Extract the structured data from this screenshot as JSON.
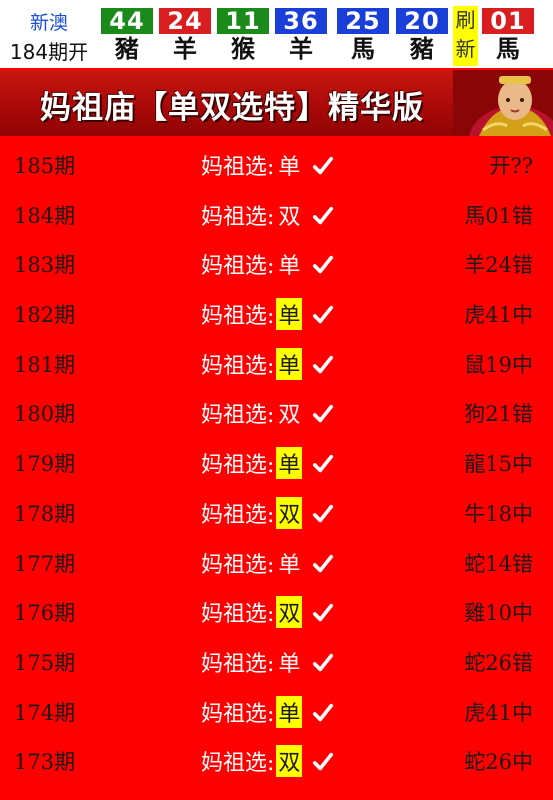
{
  "header": {
    "region": "新澳",
    "period_open": "184期开",
    "balls": [
      {
        "number": "44",
        "zodiac": "豬",
        "color": "#1a8a1a"
      },
      {
        "number": "24",
        "zodiac": "羊",
        "color": "#d81e1e"
      },
      {
        "number": "11",
        "zodiac": "猴",
        "color": "#1a8a1a"
      },
      {
        "number": "36",
        "zodiac": "羊",
        "color": "#1a3fd8"
      },
      {
        "number": "25",
        "zodiac": "馬",
        "color": "#1a3fd8"
      },
      {
        "number": "20",
        "zodiac": "豬",
        "color": "#1a3fd8"
      }
    ],
    "refresh_line1": "刷",
    "refresh_line2": "新",
    "special": {
      "number": "01",
      "zodiac": "馬",
      "color": "#d81e1e"
    }
  },
  "banner": {
    "title": "妈祖庙【单双选特】精华版"
  },
  "records": [
    {
      "period": "185期",
      "label": "妈祖选:",
      "pick": "单",
      "highlight": false,
      "result": "开??"
    },
    {
      "period": "184期",
      "label": "妈祖选:",
      "pick": "双",
      "highlight": false,
      "result": "馬01错"
    },
    {
      "period": "183期",
      "label": "妈祖选:",
      "pick": "单",
      "highlight": false,
      "result": "羊24错"
    },
    {
      "period": "182期",
      "label": "妈祖选:",
      "pick": "单",
      "highlight": true,
      "result": "虎41中"
    },
    {
      "period": "181期",
      "label": "妈祖选:",
      "pick": "单",
      "highlight": true,
      "result": "鼠19中"
    },
    {
      "period": "180期",
      "label": "妈祖选:",
      "pick": "双",
      "highlight": false,
      "result": "狗21错"
    },
    {
      "period": "179期",
      "label": "妈祖选:",
      "pick": "单",
      "highlight": true,
      "result": "龍15中"
    },
    {
      "period": "178期",
      "label": "妈祖选:",
      "pick": "双",
      "highlight": true,
      "result": "牛18中"
    },
    {
      "period": "177期",
      "label": "妈祖选:",
      "pick": "单",
      "highlight": false,
      "result": "蛇14错"
    },
    {
      "period": "176期",
      "label": "妈祖选:",
      "pick": "双",
      "highlight": true,
      "result": "雞10中"
    },
    {
      "period": "175期",
      "label": "妈祖选:",
      "pick": "单",
      "highlight": false,
      "result": "蛇26错"
    },
    {
      "period": "174期",
      "label": "妈祖选:",
      "pick": "单",
      "highlight": true,
      "result": "虎41中"
    },
    {
      "period": "173期",
      "label": "妈祖选:",
      "pick": "双",
      "highlight": true,
      "result": "蛇26中"
    }
  ],
  "icons": {
    "check": "checkmark-icon",
    "banner_image": "mazu-statue-image"
  }
}
